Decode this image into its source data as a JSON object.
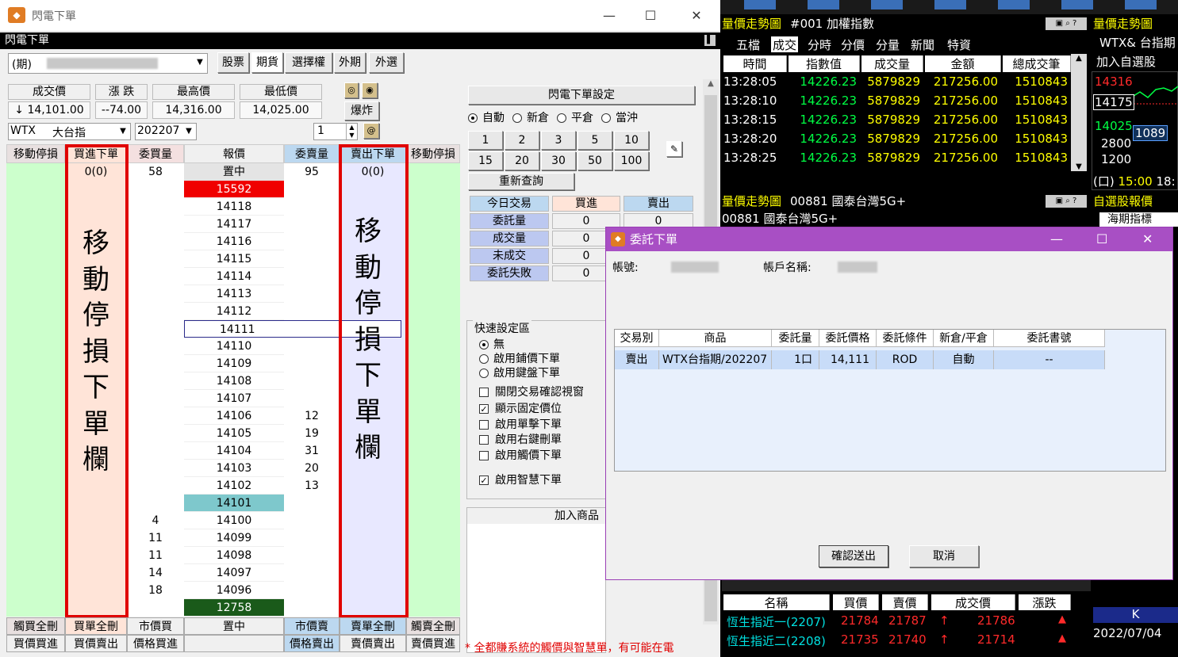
{
  "window": {
    "title": "閃電下單",
    "subtitle": "閃電下單"
  },
  "product_type": {
    "value": "(期)",
    "tabs": [
      "股票",
      "期貨",
      "選擇權",
      "外期",
      "外選"
    ]
  },
  "quote": {
    "labels": [
      "成交價",
      "漲 跌",
      "最高價",
      "最低價"
    ],
    "values": [
      "↓ 14,101.00",
      "--74.00",
      "14,316.00",
      "14,025.00"
    ],
    "explode_label": "爆炸"
  },
  "contract": {
    "symbol": "WTX",
    "name": "大台指",
    "month": "202207",
    "qty": "1"
  },
  "ladder": {
    "headers": [
      "移動停損",
      "買進下單",
      "委買量",
      "報價",
      "委賣量",
      "賣出下單",
      "移動停損"
    ],
    "top_row": {
      "buy_order": "0(0)",
      "bid_total": "58",
      "price": "置中",
      "ask_total": "95",
      "sell_order": "0(0)"
    },
    "buy_big_text": [
      "移",
      "動",
      "停",
      "損",
      "下",
      "單",
      "欄"
    ],
    "sell_big_text": [
      "移",
      "動",
      "停",
      "損",
      "下",
      "單",
      "欄"
    ],
    "rows": [
      {
        "price": "15592",
        "bid": "",
        "ask": ""
      },
      {
        "price": "14118",
        "bid": "",
        "ask": ""
      },
      {
        "price": "14117",
        "bid": "",
        "ask": ""
      },
      {
        "price": "14116",
        "bid": "",
        "ask": ""
      },
      {
        "price": "14115",
        "bid": "",
        "ask": ""
      },
      {
        "price": "14114",
        "bid": "",
        "ask": ""
      },
      {
        "price": "14113",
        "bid": "",
        "ask": ""
      },
      {
        "price": "14112",
        "bid": "",
        "ask": ""
      },
      {
        "price": "14111",
        "bid": "",
        "ask": ""
      },
      {
        "price": "14110",
        "bid": "",
        "ask": ""
      },
      {
        "price": "14109",
        "bid": "",
        "ask": ""
      },
      {
        "price": "14108",
        "bid": "",
        "ask": ""
      },
      {
        "price": "14107",
        "bid": "",
        "ask": ""
      },
      {
        "price": "14106",
        "bid": "",
        "ask": "12"
      },
      {
        "price": "14105",
        "bid": "",
        "ask": "19"
      },
      {
        "price": "14104",
        "bid": "",
        "ask": "31"
      },
      {
        "price": "14103",
        "bid": "",
        "ask": "20"
      },
      {
        "price": "14102",
        "bid": "",
        "ask": "13"
      },
      {
        "price": "14101",
        "bid": "",
        "ask": ""
      },
      {
        "price": "14100",
        "bid": "4",
        "ask": ""
      },
      {
        "price": "14099",
        "bid": "11",
        "ask": ""
      },
      {
        "price": "14098",
        "bid": "11",
        "ask": ""
      },
      {
        "price": "14097",
        "bid": "14",
        "ask": ""
      },
      {
        "price": "14096",
        "bid": "18",
        "ask": ""
      },
      {
        "price": "12758",
        "bid": "",
        "ask": ""
      }
    ],
    "bottom1": [
      "觸買全刪",
      "買單全刪",
      "市價買",
      "置中",
      "市價賣",
      "賣單全刪",
      "觸賣全刪"
    ],
    "bottom2": [
      "買價買進",
      "買價賣出",
      "價格買進",
      "",
      "價格賣出",
      "賣價賣出",
      "賣價買進"
    ]
  },
  "settings": {
    "title": "閃電下單設定",
    "mode_options": [
      "自動",
      "新倉",
      "平倉",
      "當沖"
    ],
    "qty_buttons": [
      "1",
      "2",
      "3",
      "5",
      "10",
      "15",
      "20",
      "30",
      "50",
      "100"
    ],
    "requery": "重新查詢",
    "stats_headers": [
      "今日交易",
      "買進",
      "賣出"
    ],
    "stats_rows": [
      {
        "label": "委託量",
        "buy": "0",
        "sell": "0"
      },
      {
        "label": "成交量",
        "buy": "0",
        "sell": ""
      },
      {
        "label": "未成交",
        "buy": "0",
        "sell": ""
      },
      {
        "label": "委託失敗",
        "buy": "0",
        "sell": ""
      }
    ],
    "quick_title": "快速設定區",
    "quick_radios": [
      "無",
      "啟用鋪價下單",
      "啟用鍵盤下單"
    ],
    "checkboxes": [
      "關閉交易確認視窗",
      "顯示固定價位",
      "啟用單擊下單",
      "啟用右鍵刪單",
      "啟用觸價下單",
      "啟用智慧下單"
    ],
    "add_product": "加入商品",
    "warning": "* 全都賺系統的觸價與智慧單，有可能在電"
  },
  "right_panel": {
    "trend_title": "量價走勢圖",
    "index_title": "#001 加權指數",
    "tabs": [
      "五檔",
      "成交",
      "分時",
      "分價",
      "分量",
      "新聞",
      "特資"
    ],
    "table_headers": [
      "時間",
      "指數值",
      "成交量",
      "金額",
      "總成交筆"
    ],
    "ticks": [
      [
        "13:28:05",
        "14226.23",
        "5879829",
        "217256.00",
        "1510843"
      ],
      [
        "13:28:10",
        "14226.23",
        "5879829",
        "217256.00",
        "1510843"
      ],
      [
        "13:28:15",
        "14226.23",
        "5879829",
        "217256.00",
        "1510843"
      ],
      [
        "13:28:20",
        "14226.23",
        "5879829",
        "217256.00",
        "1510843"
      ],
      [
        "13:28:25",
        "14226.23",
        "5879829",
        "217256.00",
        "1510843"
      ]
    ],
    "mini": {
      "title": "量價走勢圖",
      "sub": "WTX& 台指期",
      "add": "加入自選股",
      "p1": "14316",
      "p2": "14175",
      "p3": "14025",
      "v1": "2800",
      "v2": "1200",
      "v3": "1089",
      "time": "15:00",
      "time2": "18:"
    },
    "trend2_title": "量價走勢圖",
    "trend2_code": "00881 國泰台灣5G+",
    "trend2_sub": "00881 國泰台灣5G+",
    "watch_title": "自選股報價",
    "watch_tab": "海期指標",
    "hk_headers": [
      "名稱",
      "買價",
      "賣價",
      "成交價",
      "漲跌"
    ],
    "hk_rows": [
      {
        "name": "恆生指近一(2207)",
        "bid": "21784",
        "ask": "21787",
        "last": "21786"
      },
      {
        "name": "恆生指近二(2208)",
        "bid": "21735",
        "ask": "21740",
        "last": "21714"
      }
    ],
    "k_label": "K",
    "date": "2022/07/04"
  },
  "modal": {
    "title": "委託下單",
    "account_label": "帳號:",
    "account_name_label": "帳戶名稱:",
    "headers": [
      "交易別",
      "商品",
      "委託量",
      "委託價格",
      "委託條件",
      "新倉/平倉",
      "委託書號"
    ],
    "row": [
      "賣出",
      "WTX台指期/202207",
      "1口",
      "14,111",
      "ROD",
      "自動",
      "--"
    ],
    "confirm": "確認送出",
    "cancel": "取消"
  }
}
